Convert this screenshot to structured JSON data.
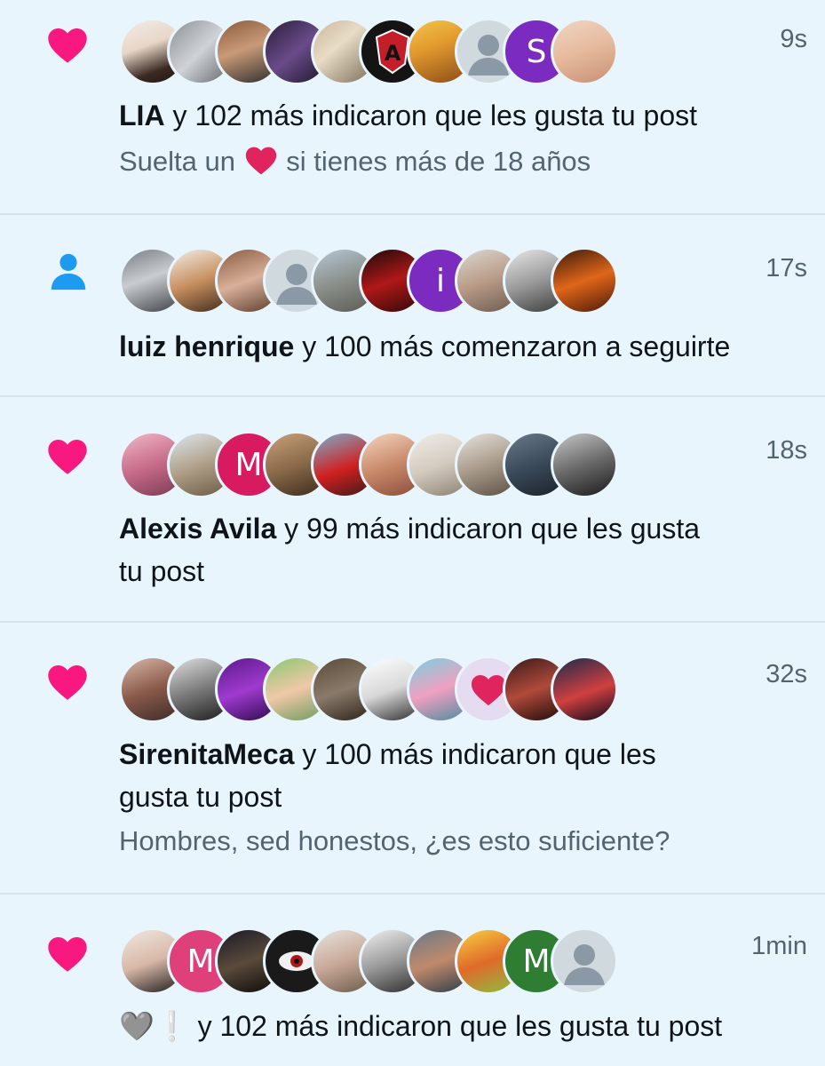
{
  "notifications": [
    {
      "type": "like",
      "icon": "heart-icon",
      "time": "9s",
      "name": "LIA",
      "action": "y 102 más indicaron que les gusta tu post",
      "subtext_before": "Suelta un",
      "subtext_after": "si tienes más de 18 años",
      "avatars": [
        "photo",
        "photo",
        "photo",
        "photo",
        "photo",
        "photo",
        "photo",
        "default",
        "S",
        "photo"
      ]
    },
    {
      "type": "follow",
      "icon": "person-icon",
      "time": "17s",
      "name": "luiz henrique",
      "action": "y 100 más comenzaron a seguirte",
      "avatars": [
        "photo",
        "photo",
        "photo",
        "default",
        "photo",
        "photo",
        "i",
        "photo",
        "photo",
        "photo"
      ]
    },
    {
      "type": "like",
      "icon": "heart-icon",
      "time": "18s",
      "name": "Alexis Avila",
      "action": "y 99 más indicaron que les gusta",
      "action_line2": "tu post",
      "avatars": [
        "photo",
        "photo",
        "M",
        "photo",
        "photo",
        "photo",
        "photo",
        "photo",
        "photo",
        "photo"
      ]
    },
    {
      "type": "like",
      "icon": "heart-icon",
      "time": "32s",
      "name": "SirenitaMeca",
      "action": "y 100 más indicaron que les",
      "action_line2": "gusta tu post",
      "subtext": "Hombres, sed honestos, ¿es esto suficiente?",
      "avatars": [
        "photo",
        "photo",
        "photo",
        "photo",
        "photo",
        "photo",
        "photo",
        "heart",
        "photo",
        "photo"
      ]
    },
    {
      "type": "like",
      "icon": "heart-icon",
      "time": "1min",
      "name_emoji": "🩶❕",
      "action": "y 102 más indicaron que les gusta tu post",
      "avatars": [
        "photo",
        "M",
        "photo",
        "photo",
        "photo",
        "photo",
        "photo",
        "photo",
        "M",
        "default"
      ]
    }
  ],
  "colors": {
    "background": "#e8f5fd",
    "like_heart": "#f91880",
    "follow_icon": "#1d9bf0",
    "secondary_text": "#536471",
    "divider": "#d3e2ec"
  }
}
